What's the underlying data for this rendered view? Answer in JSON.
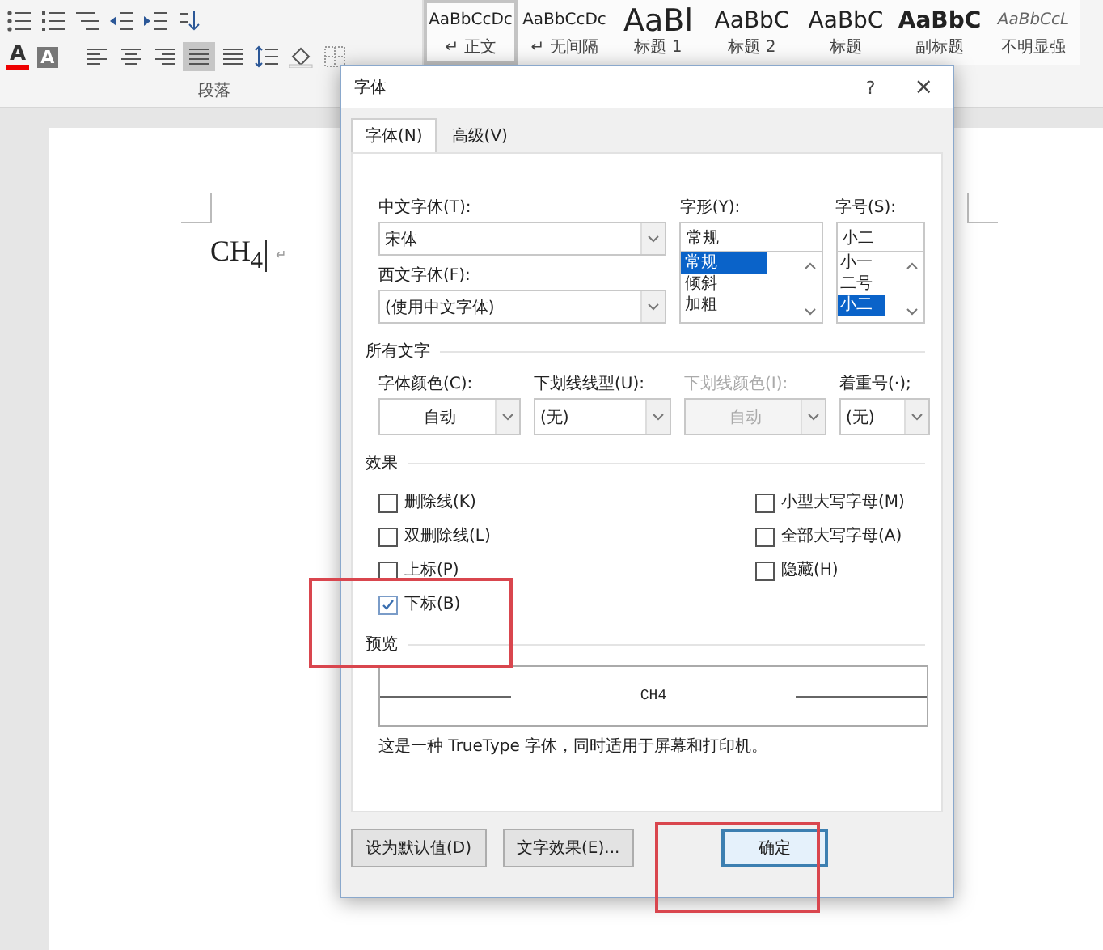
{
  "ribbon": {
    "font_color_button": "A",
    "shading_button": "A",
    "group_label": "段落",
    "align_buttons": [
      {
        "selected": false
      },
      {
        "selected": false
      },
      {
        "selected": false
      },
      {
        "selected": true
      },
      {
        "selected": false
      }
    ],
    "styles": [
      {
        "sample": "AaBbCcDc",
        "name": "↵ 正文",
        "kind": "normal",
        "selected": true
      },
      {
        "sample": "AaBbCcDc",
        "name": "↵ 无间隔",
        "kind": "normal",
        "selected": false
      },
      {
        "sample": "AaBl",
        "name": "标题 1",
        "kind": "heading1",
        "selected": false
      },
      {
        "sample": "AaBbC",
        "name": "标题 2",
        "kind": "heading2",
        "selected": false
      },
      {
        "sample": "AaBbC",
        "name": "标题",
        "kind": "title",
        "selected": false
      },
      {
        "sample": "AaBbC",
        "name": "副标题",
        "kind": "subtitle",
        "selected": false
      },
      {
        "sample": "AaBbCcL",
        "name": "不明显强",
        "kind": "emphasis",
        "selected": false
      }
    ]
  },
  "document": {
    "text": "CH$_{4}$",
    "paragraph_mark": "↵"
  },
  "dialog": {
    "title": "字体",
    "help": "?",
    "close": "×",
    "tabs": [
      {
        "label": "字体(N)",
        "selected": true
      },
      {
        "label": "高级(V)",
        "selected": false
      }
    ],
    "chinese_font": {
      "label": "中文字体(T):",
      "value": "宋体"
    },
    "western_font": {
      "label": "西文字体(F):",
      "value": "(使用中文字体)"
    },
    "style": {
      "label": "字形(Y):",
      "value": "常规",
      "options": [
        {
          "label": "常规",
          "selected": true
        },
        {
          "label": "倾斜",
          "selected": false
        },
        {
          "label": "加粗",
          "selected": false
        }
      ]
    },
    "size": {
      "label": "字号(S):",
      "value": "小二",
      "options": [
        {
          "label": "小一",
          "selected": false
        },
        {
          "label": "二号",
          "selected": false
        },
        {
          "label": "小二",
          "selected": true
        }
      ]
    },
    "all_text": {
      "heading": "所有文字",
      "fields": [
        {
          "label": "字体颜色(C):",
          "value": "自动",
          "kind": "color",
          "disabled": false
        },
        {
          "label": "下划线线型(U):",
          "value": "(无)",
          "kind": "text",
          "disabled": false
        },
        {
          "label": "下划线颜色(I):",
          "value": "自动",
          "kind": "color",
          "disabled": true
        },
        {
          "label": "着重号(·);",
          "value": "(无)",
          "kind": "text",
          "disabled": false
        }
      ]
    },
    "effects": {
      "heading": "效果",
      "left": [
        {
          "label": "删除线(K)",
          "checked": false
        },
        {
          "label": "双删除线(L)",
          "checked": false
        },
        {
          "label": "上标(P)",
          "checked": false
        },
        {
          "label": "下标(B)",
          "checked": true
        }
      ],
      "right": [
        {
          "label": "小型大写字母(M)",
          "checked": false
        },
        {
          "label": "全部大写字母(A)",
          "checked": false
        },
        {
          "label": "隐藏(H)",
          "checked": false
        }
      ]
    },
    "preview": {
      "heading": "预览",
      "sample": "CH4",
      "note": "这是一种 TrueType 字体，同时适用于屏幕和打印机。"
    },
    "buttons": [
      {
        "label": "设为默认值(D)",
        "default": false
      },
      {
        "label": "文字效果(E)...",
        "default": false
      },
      {
        "label": "确定",
        "default": true
      }
    ]
  }
}
